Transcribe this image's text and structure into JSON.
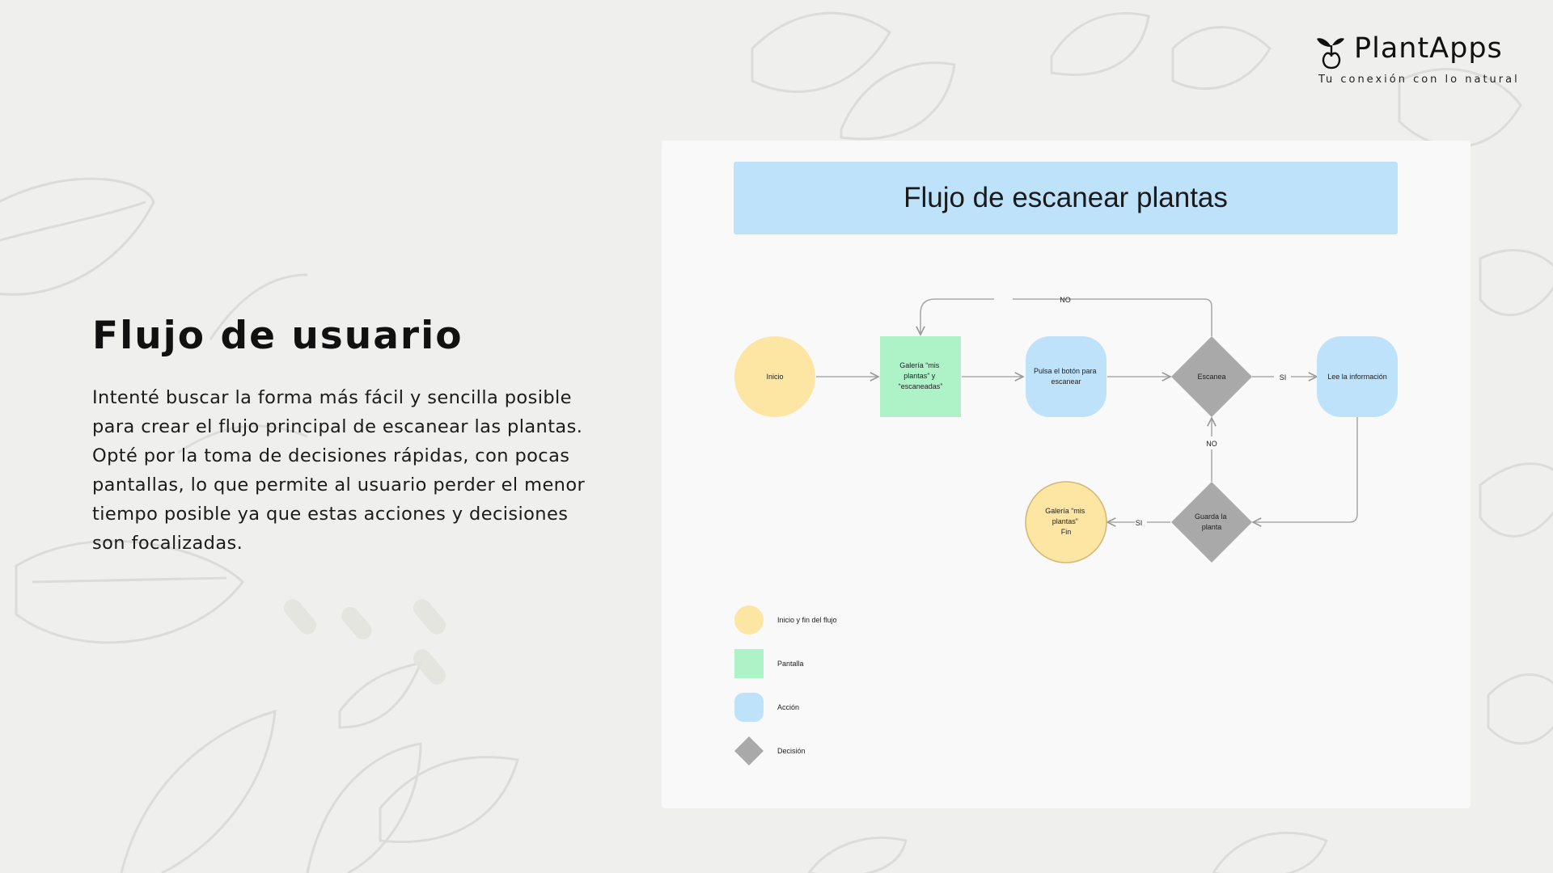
{
  "brand": {
    "name": "PlantApps",
    "tagline": "Tu conexión con lo natural"
  },
  "section": {
    "title": "Flujo de usuario",
    "body": "Intenté buscar la forma más fácil y sencilla posible para crear el flujo principal de escanear las plantas. Opté por la toma de decisiones rápidas, con pocas pantallas, lo que permite al usuario perder el menor tiempo posible ya que estas acciones y decisiones son focalizadas."
  },
  "diagram": {
    "title": "Flujo de escanear plantas",
    "nodes": {
      "inicio": "Inicio",
      "galeria": [
        "Galería “mis",
        "plantas” y",
        "“escaneadas”"
      ],
      "pulsa": [
        "Pulsa el botón para",
        "escanear"
      ],
      "escanea": "Escanea",
      "lee": "Lee la información",
      "guarda": [
        "Guarda la",
        "planta"
      ],
      "fin": [
        "Galería “mis",
        "plantas”",
        "Fin"
      ]
    },
    "edge_labels": {
      "no_top": "NO",
      "si_right": "SI",
      "no_mid": "NO",
      "si_bottom": "SI"
    },
    "legend": [
      {
        "shape": "circle",
        "color": "#fde6a4",
        "label": "Inicio y fin del flujo"
      },
      {
        "shape": "square",
        "color": "#aef2c8",
        "label": "Pantalla"
      },
      {
        "shape": "rounded",
        "color": "#bfe2fb",
        "label": "Acción"
      },
      {
        "shape": "diamond",
        "color": "#a9a9a9",
        "label": "Decisión"
      }
    ],
    "colors": {
      "start_end": "#fde6a4",
      "screen": "#aef2c8",
      "action": "#bfe2fb",
      "decision": "#a9a9a9",
      "header": "#bfe2fb"
    }
  }
}
